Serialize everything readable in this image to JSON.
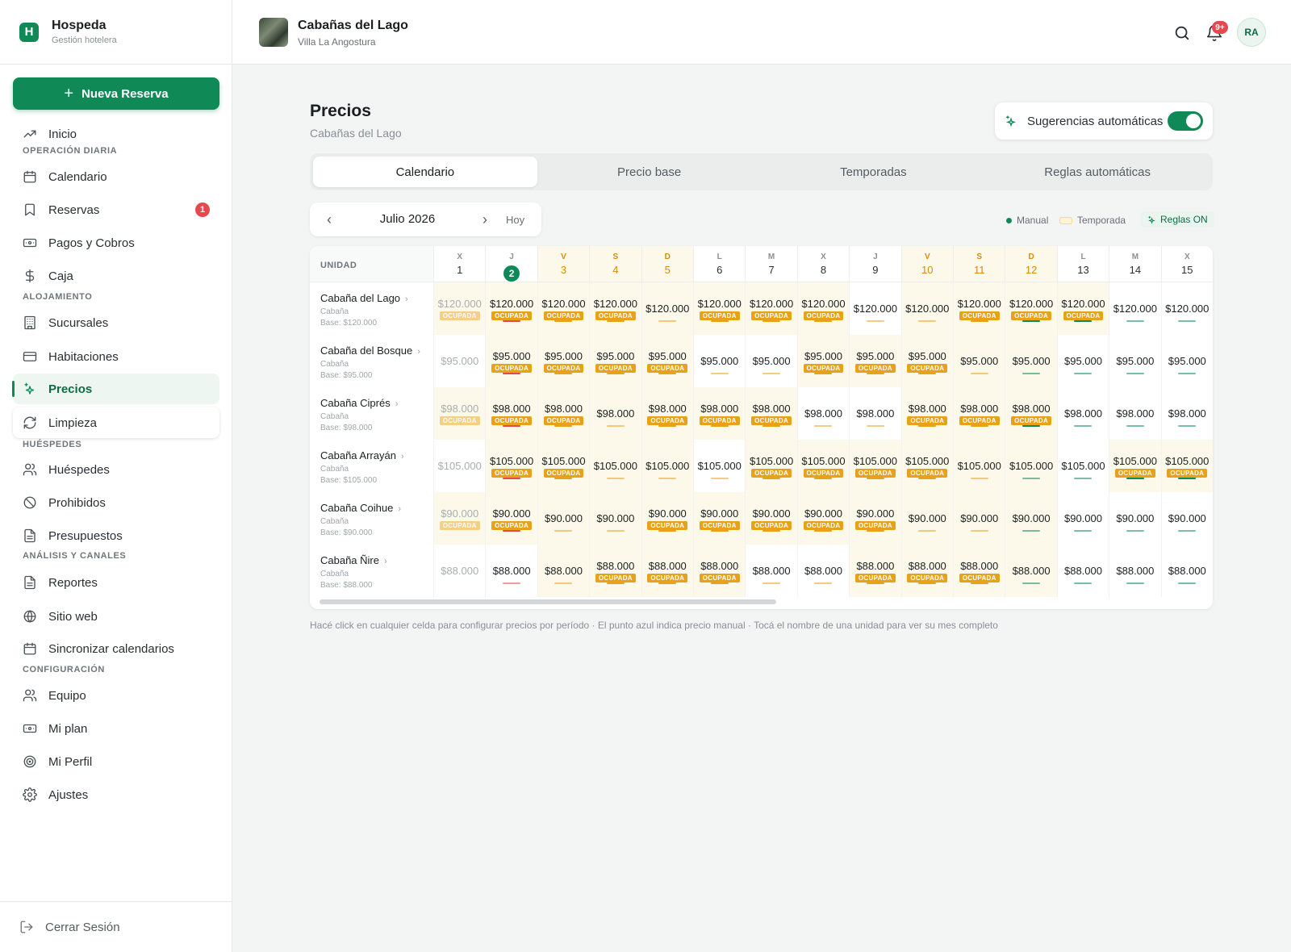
{
  "brand": {
    "name": "Hospeda",
    "subtitle": "Gestión hotelera",
    "logo_letter": "H"
  },
  "sidebar": {
    "new_button": "Nueva Reserva",
    "items": [
      {
        "label": "Inicio",
        "icon": "trending-up-icon"
      },
      {
        "section": "OPERACIÓN DIARIA"
      },
      {
        "label": "Calendario",
        "icon": "calendar-icon"
      },
      {
        "label": "Reservas",
        "icon": "bookmark-icon",
        "badge": "1"
      },
      {
        "label": "Pagos y Cobros",
        "icon": "banknote-icon"
      },
      {
        "label": "Caja",
        "icon": "dollar-icon"
      },
      {
        "section": "ALOJAMIENTO"
      },
      {
        "label": "Sucursales",
        "icon": "building-icon"
      },
      {
        "label": "Habitaciones",
        "icon": "room-icon"
      },
      {
        "label": "Precios",
        "icon": "sparkle-icon",
        "active": true
      },
      {
        "label": "Limpieza",
        "icon": "refresh-icon"
      },
      {
        "section": "HUÉSPEDES"
      },
      {
        "label": "Huéspedes",
        "icon": "users-icon"
      },
      {
        "label": "Prohibidos",
        "icon": "ban-icon"
      },
      {
        "label": "Presupuestos",
        "icon": "file-icon"
      },
      {
        "section": "ANÁLISIS Y CANALES"
      },
      {
        "label": "Reportes",
        "icon": "file-icon"
      },
      {
        "label": "Sitio web",
        "icon": "globe-icon"
      },
      {
        "label": "Sincronizar calendarios",
        "icon": "calendar-icon"
      },
      {
        "section": "CONFIGURACIÓN"
      },
      {
        "label": "Equipo",
        "icon": "users-icon"
      },
      {
        "label": "Mi plan",
        "icon": "banknote-icon"
      },
      {
        "label": "Mi Perfil",
        "icon": "target-icon"
      },
      {
        "label": "Ajustes",
        "icon": "gear-icon"
      }
    ],
    "logout": "Cerrar Sesión"
  },
  "header": {
    "property_name": "Cabañas del Lago",
    "property_location": "Villa La Angostura",
    "notif_badge": "9+",
    "avatar_initials": "RA"
  },
  "page": {
    "title": "Precios",
    "subtitle": "Cabañas del Lago",
    "auto_suggestions_label": "Sugerencias automáticas",
    "auto_suggestions_on": true,
    "tabs": [
      "Calendario",
      "Precio base",
      "Temporadas",
      "Reglas automáticas"
    ],
    "active_tab": 0,
    "month_label": "Julio 2026",
    "today_label": "Hoy",
    "legend": {
      "manual": "Manual",
      "season": "Temporada",
      "rules": "Reglas ON"
    },
    "unit_header": "UNIDAD",
    "hint": "Hacé click en cualquier celda para configurar precios por período · El punto azul indica precio manual · Tocá el nombre de una unidad para ver su mes completo"
  },
  "colors": {
    "accent": "#0f8a57",
    "occupied": "#e8a21a",
    "weekend": "#fdf9ea",
    "badge": "#e5484d"
  },
  "calendar": {
    "today_index": 1,
    "occupied_label": "OCUPADA",
    "days": [
      {
        "wd": "X",
        "n": "1"
      },
      {
        "wd": "J",
        "n": "2"
      },
      {
        "wd": "V",
        "n": "3",
        "weekend": true
      },
      {
        "wd": "S",
        "n": "4",
        "weekend": true
      },
      {
        "wd": "D",
        "n": "5",
        "weekend": true
      },
      {
        "wd": "L",
        "n": "6"
      },
      {
        "wd": "M",
        "n": "7"
      },
      {
        "wd": "X",
        "n": "8"
      },
      {
        "wd": "J",
        "n": "9"
      },
      {
        "wd": "V",
        "n": "10",
        "weekend": true
      },
      {
        "wd": "S",
        "n": "11",
        "weekend": true
      },
      {
        "wd": "D",
        "n": "12",
        "weekend": true
      },
      {
        "wd": "L",
        "n": "13"
      },
      {
        "wd": "M",
        "n": "14"
      },
      {
        "wd": "X",
        "n": "15"
      }
    ],
    "units": [
      {
        "name": "Cabaña del Lago",
        "type": "Cabaña",
        "base": "Base: $120.000",
        "price": "$120.000",
        "occ": [
          1,
          1,
          1,
          1,
          0,
          1,
          1,
          1,
          0,
          0,
          1,
          1,
          1,
          0,
          0
        ]
      },
      {
        "name": "Cabaña del Bosque",
        "type": "Cabaña",
        "base": "Base: $95.000",
        "price": "$95.000",
        "occ": [
          0,
          1,
          1,
          1,
          1,
          0,
          0,
          1,
          1,
          1,
          0,
          0,
          0,
          0,
          0
        ]
      },
      {
        "name": "Cabaña Ciprés",
        "type": "Cabaña",
        "base": "Base: $98.000",
        "price": "$98.000",
        "occ": [
          1,
          1,
          1,
          0,
          1,
          1,
          1,
          0,
          0,
          1,
          1,
          1,
          0,
          0,
          0
        ]
      },
      {
        "name": "Cabaña Arrayán",
        "type": "Cabaña",
        "base": "Base: $105.000",
        "price": "$105.000",
        "occ": [
          0,
          1,
          1,
          0,
          0,
          0,
          1,
          1,
          1,
          1,
          0,
          0,
          0,
          1,
          1
        ]
      },
      {
        "name": "Cabaña Coihue",
        "type": "Cabaña",
        "base": "Base: $90.000",
        "price": "$90.000",
        "occ": [
          1,
          1,
          0,
          0,
          1,
          1,
          1,
          1,
          1,
          0,
          0,
          0,
          0,
          0,
          0
        ]
      },
      {
        "name": "Cabaña Ñire",
        "type": "Cabaña",
        "base": "Base: $88.000",
        "price": "$88.000",
        "occ": [
          0,
          0,
          0,
          1,
          1,
          1,
          0,
          0,
          1,
          1,
          1,
          0,
          0,
          0,
          0
        ]
      }
    ]
  }
}
